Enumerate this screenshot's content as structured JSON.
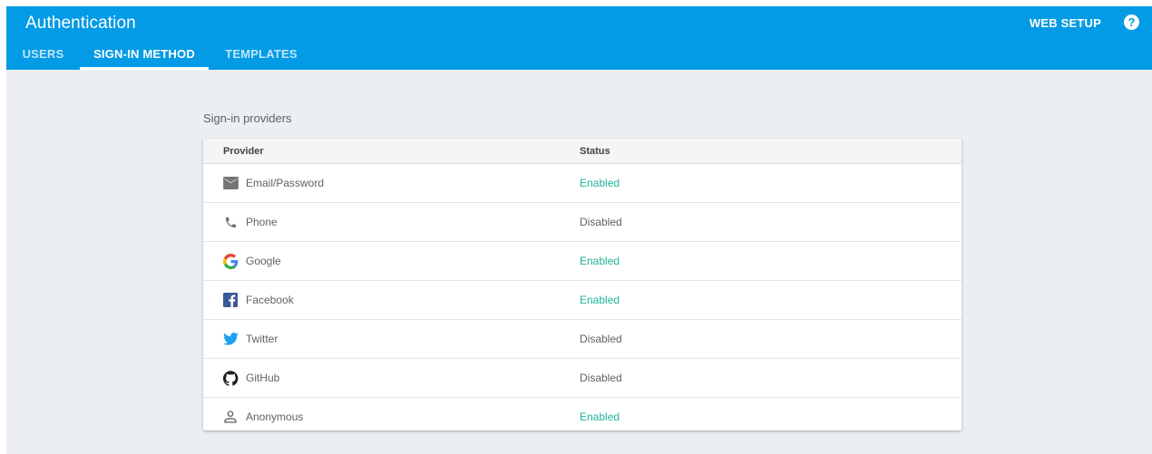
{
  "header": {
    "title": "Authentication",
    "web_setup": "WEB SETUP",
    "help_glyph": "?"
  },
  "tabs": [
    {
      "label": "USERS",
      "active": false
    },
    {
      "label": "SIGN-IN METHOD",
      "active": true
    },
    {
      "label": "TEMPLATES",
      "active": false
    }
  ],
  "section": {
    "label": "Sign-in providers"
  },
  "table": {
    "columns": [
      "Provider",
      "Status"
    ],
    "rows": [
      {
        "icon": "email-icon",
        "provider": "Email/Password",
        "status": "Enabled"
      },
      {
        "icon": "phone-icon",
        "provider": "Phone",
        "status": "Disabled"
      },
      {
        "icon": "google-icon",
        "provider": "Google",
        "status": "Enabled"
      },
      {
        "icon": "facebook-icon",
        "provider": "Facebook",
        "status": "Enabled"
      },
      {
        "icon": "twitter-icon",
        "provider": "Twitter",
        "status": "Disabled"
      },
      {
        "icon": "github-icon",
        "provider": "GitHub",
        "status": "Disabled"
      },
      {
        "icon": "anonymous-icon",
        "provider": "Anonymous",
        "status": "Enabled"
      }
    ]
  },
  "colors": {
    "appbar": "#039be5",
    "background": "#eceff1",
    "enabled": "#1eb49a",
    "disabled": "#616161"
  }
}
